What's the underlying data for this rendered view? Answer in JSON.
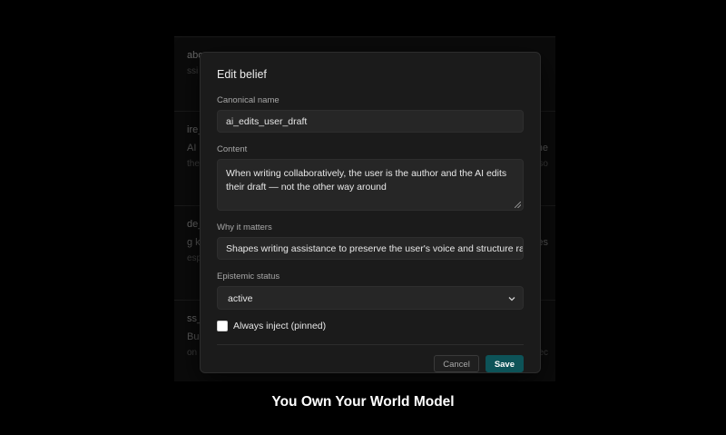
{
  "background": {
    "cards": [
      {
        "title": "abo",
        "line": "",
        "sub": "ssi",
        "right_line": "",
        "right_sub": ""
      },
      {
        "title": "ire_",
        "line": "AI l",
        "sub": "the",
        "right_line": "ne",
        "right_sub": "iso"
      },
      {
        "title": "de_",
        "line": "g k",
        "sub": "esp",
        "right_line": "es",
        "right_sub": ""
      },
      {
        "title": "ss_",
        "line": "Bus",
        "sub": "on",
        "right_line": "",
        "right_sub": "ec"
      }
    ]
  },
  "modal": {
    "title": "Edit belief",
    "canonical_name": {
      "label": "Canonical name",
      "value": "ai_edits_user_draft"
    },
    "content": {
      "label": "Content",
      "value": "When writing collaboratively, the user is the author and the AI edits their draft — not the other way around"
    },
    "why": {
      "label": "Why it matters",
      "value": "Shapes writing assistance to preserve the user's voice and structure rathe"
    },
    "status": {
      "label": "Epistemic status",
      "value": "active"
    },
    "pinned": {
      "label": "Always inject (pinned)",
      "checked": false
    },
    "cancel_label": "Cancel",
    "save_label": "Save"
  },
  "caption": "You Own Your World Model",
  "colors": {
    "accent": "#0d5358",
    "background": "#000000",
    "modal": "#1b1b1b"
  },
  "icons": {
    "select": "chevron-down-icon",
    "textarea": "resize-grip-icon"
  }
}
